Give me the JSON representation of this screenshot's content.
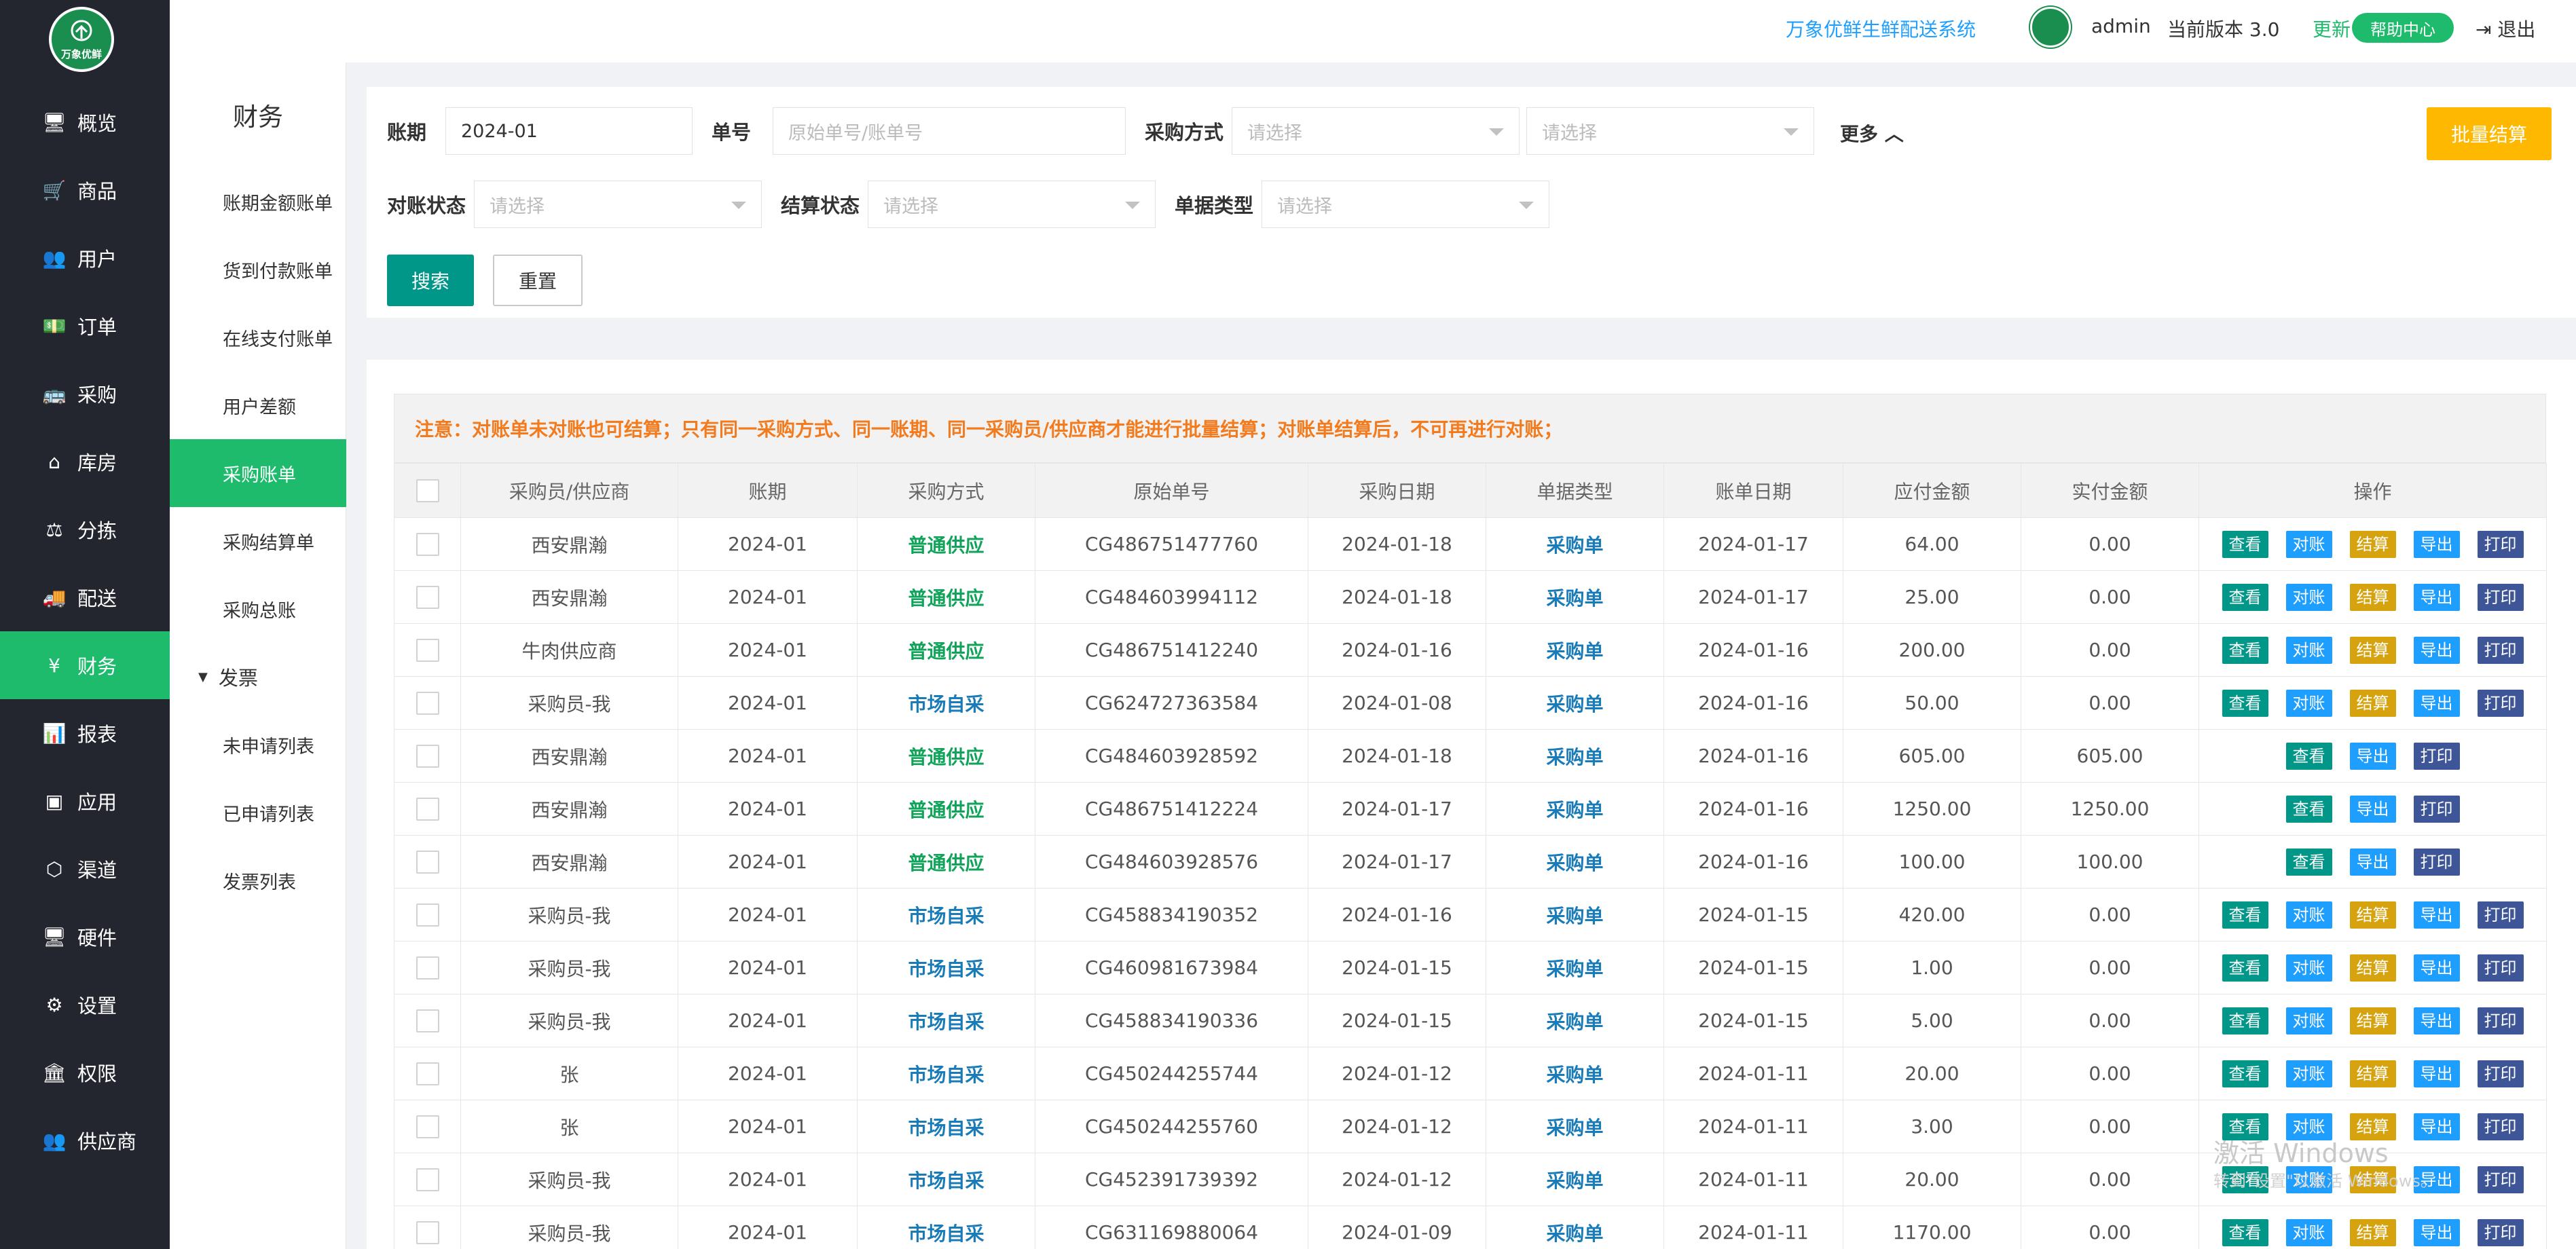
{
  "logo": {
    "text": "万象优鲜"
  },
  "nav": {
    "items": [
      {
        "icon": "monitor-icon",
        "glyph": "🖥",
        "label": "概览"
      },
      {
        "icon": "cart-icon",
        "glyph": "🛒",
        "label": "商品"
      },
      {
        "icon": "users-icon",
        "glyph": "👥",
        "label": "用户"
      },
      {
        "icon": "money-icon",
        "glyph": "💵",
        "label": "订单"
      },
      {
        "icon": "bus-icon",
        "glyph": "🚌",
        "label": "采购"
      },
      {
        "icon": "home-icon",
        "glyph": "⌂",
        "label": "库房"
      },
      {
        "icon": "scale-icon",
        "glyph": "⚖",
        "label": "分拣"
      },
      {
        "icon": "truck-icon",
        "glyph": "🚚",
        "label": "配送"
      },
      {
        "icon": "yen-icon",
        "glyph": "¥",
        "label": "财务"
      },
      {
        "icon": "bar-chart-icon",
        "glyph": "📊",
        "label": "报表"
      },
      {
        "icon": "apps-icon",
        "glyph": "▣",
        "label": "应用"
      },
      {
        "icon": "cube-icon",
        "glyph": "⬡",
        "label": "渠道"
      },
      {
        "icon": "desktop-icon",
        "glyph": "🖥",
        "label": "硬件"
      },
      {
        "icon": "puzzle-icon",
        "glyph": "⚙",
        "label": "设置"
      },
      {
        "icon": "bank-icon",
        "glyph": "🏛",
        "label": "权限"
      },
      {
        "icon": "group-icon",
        "glyph": "👥",
        "label": "供应商"
      }
    ]
  },
  "submenu": {
    "title": "财务",
    "items": [
      "账期金额账单",
      "货到付款账单",
      "在线支付账单",
      "用户差额",
      "采购账单",
      "采购结算单",
      "采购总账"
    ],
    "group": "发票",
    "group_items": [
      "未申请列表",
      "已申请列表",
      "发票列表"
    ]
  },
  "header": {
    "system_name": "万象优鲜生鲜配送系统",
    "username": "admin",
    "version": "当前版本  3.0",
    "update": "更新",
    "help": "帮助中心",
    "logout": "退出"
  },
  "search": {
    "period_label": "账期",
    "period_value": "2024-01",
    "number_label": "单号",
    "number_placeholder": "原始单号/账单号",
    "method_label": "采购方式",
    "select_placeholder": "请选择",
    "more": "更多",
    "recon_label": "对账状态",
    "settle_label": "结算状态",
    "doctype_label": "单据类型",
    "search_btn": "搜索",
    "reset_btn": "重置",
    "batch_btn": "批量结算"
  },
  "notice": "注意：对账单未对账也可结算；只有同一采购方式、同一账期、同一采购员/供应商才能进行批量结算；对账单结算后，不可再进行对账；",
  "table": {
    "headers": [
      "采购员/供应商",
      "账期",
      "采购方式",
      "原始单号",
      "采购日期",
      "单据类型",
      "账单日期",
      "应付金额",
      "实付金额",
      "操作"
    ],
    "actions": {
      "view": "查看",
      "reconcile": "对账",
      "settle": "结算",
      "export": "导出",
      "print": "打印"
    },
    "rows": [
      {
        "supplier": "西安鼎瀚",
        "period": "2024-01",
        "method": "普通供应",
        "order": "CG486751477760",
        "pdate": "2024-01-18",
        "type": "采购单",
        "bdate": "2024-01-17",
        "payable": "64.00",
        "paid": "0.00",
        "full": true
      },
      {
        "supplier": "西安鼎瀚",
        "period": "2024-01",
        "method": "普通供应",
        "order": "CG484603994112",
        "pdate": "2024-01-18",
        "type": "采购单",
        "bdate": "2024-01-17",
        "payable": "25.00",
        "paid": "0.00",
        "full": true
      },
      {
        "supplier": "牛肉供应商",
        "period": "2024-01",
        "method": "普通供应",
        "order": "CG486751412240",
        "pdate": "2024-01-16",
        "type": "采购单",
        "bdate": "2024-01-16",
        "payable": "200.00",
        "paid": "0.00",
        "full": true
      },
      {
        "supplier": "采购员-我",
        "period": "2024-01",
        "method": "市场自采",
        "order": "CG624727363584",
        "pdate": "2024-01-08",
        "type": "采购单",
        "bdate": "2024-01-16",
        "payable": "50.00",
        "paid": "0.00",
        "full": true
      },
      {
        "supplier": "西安鼎瀚",
        "period": "2024-01",
        "method": "普通供应",
        "order": "CG484603928592",
        "pdate": "2024-01-18",
        "type": "采购单",
        "bdate": "2024-01-16",
        "payable": "605.00",
        "paid": "605.00",
        "full": false
      },
      {
        "supplier": "西安鼎瀚",
        "period": "2024-01",
        "method": "普通供应",
        "order": "CG486751412224",
        "pdate": "2024-01-17",
        "type": "采购单",
        "bdate": "2024-01-16",
        "payable": "1250.00",
        "paid": "1250.00",
        "full": false
      },
      {
        "supplier": "西安鼎瀚",
        "period": "2024-01",
        "method": "普通供应",
        "order": "CG484603928576",
        "pdate": "2024-01-17",
        "type": "采购单",
        "bdate": "2024-01-16",
        "payable": "100.00",
        "paid": "100.00",
        "full": false
      },
      {
        "supplier": "采购员-我",
        "period": "2024-01",
        "method": "市场自采",
        "order": "CG458834190352",
        "pdate": "2024-01-16",
        "type": "采购单",
        "bdate": "2024-01-15",
        "payable": "420.00",
        "paid": "0.00",
        "full": true
      },
      {
        "supplier": "采购员-我",
        "period": "2024-01",
        "method": "市场自采",
        "order": "CG460981673984",
        "pdate": "2024-01-15",
        "type": "采购单",
        "bdate": "2024-01-15",
        "payable": "1.00",
        "paid": "0.00",
        "full": true
      },
      {
        "supplier": "采购员-我",
        "period": "2024-01",
        "method": "市场自采",
        "order": "CG458834190336",
        "pdate": "2024-01-15",
        "type": "采购单",
        "bdate": "2024-01-15",
        "payable": "5.00",
        "paid": "0.00",
        "full": true
      },
      {
        "supplier": "张",
        "period": "2024-01",
        "method": "市场自采",
        "order": "CG450244255744",
        "pdate": "2024-01-12",
        "type": "采购单",
        "bdate": "2024-01-11",
        "payable": "20.00",
        "paid": "0.00",
        "full": true
      },
      {
        "supplier": "张",
        "period": "2024-01",
        "method": "市场自采",
        "order": "CG450244255760",
        "pdate": "2024-01-12",
        "type": "采购单",
        "bdate": "2024-01-11",
        "payable": "3.00",
        "paid": "0.00",
        "full": true
      },
      {
        "supplier": "采购员-我",
        "period": "2024-01",
        "method": "市场自采",
        "order": "CG452391739392",
        "pdate": "2024-01-12",
        "type": "采购单",
        "bdate": "2024-01-11",
        "payable": "20.00",
        "paid": "0.00",
        "full": true
      },
      {
        "supplier": "采购员-我",
        "period": "2024-01",
        "method": "市场自采",
        "order": "CG631169880064",
        "pdate": "2024-01-09",
        "type": "采购单",
        "bdate": "2024-01-11",
        "payable": "1170.00",
        "paid": "0.00",
        "full": true
      }
    ]
  },
  "watermark": {
    "line1": "激活 Windows",
    "line2": "转到\"设置\"以激活 Windows。"
  },
  "colors": {
    "nav_bg": "#23262e",
    "active_green": "#1fbb6c",
    "teal": "#009688",
    "blue": "#1e9fff",
    "gold": "#ffb800",
    "notice": "#f37b1d"
  }
}
